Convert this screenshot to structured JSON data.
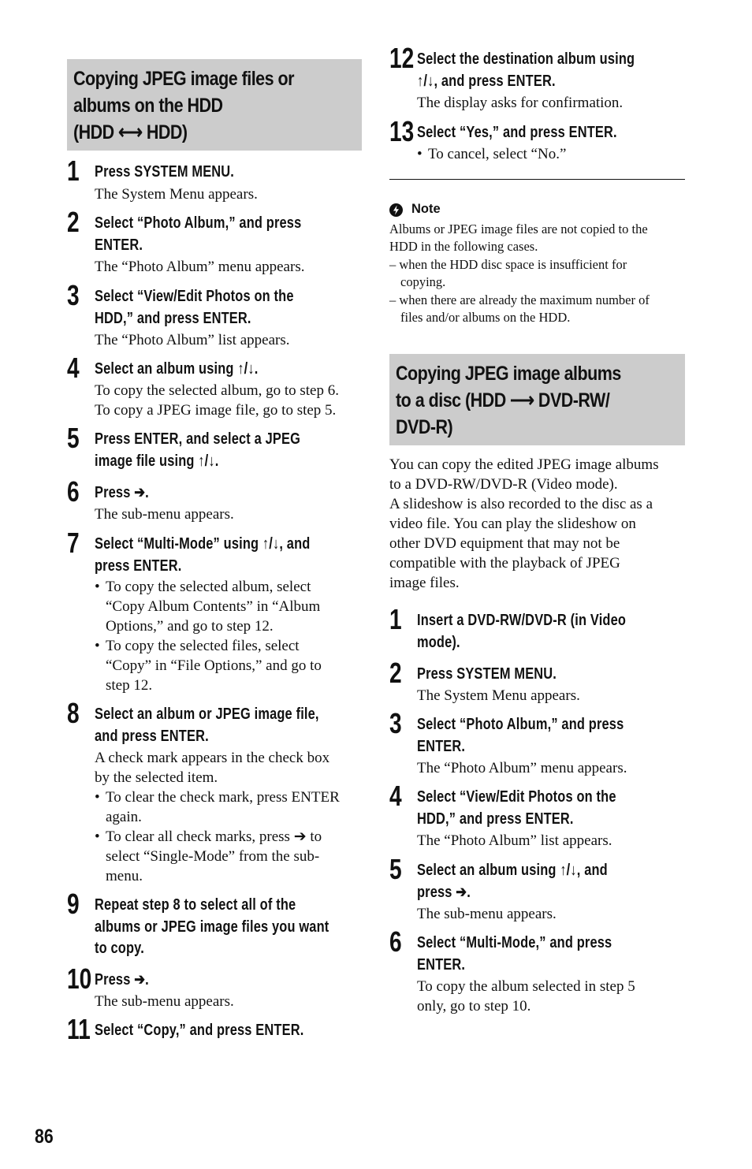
{
  "page_number": "86",
  "section1": {
    "heading_lines": [
      "Copying JPEG image files or",
      "albums on the HDD",
      "(HDD ⟷ HDD)"
    ],
    "steps": [
      {
        "num": "1",
        "title": [
          "Press SYSTEM MENU."
        ],
        "body": [
          "The System Menu appears."
        ]
      },
      {
        "num": "2",
        "title": [
          "Select “Photo Album,” and press",
          "ENTER."
        ],
        "body": [
          "The “Photo Album” menu appears."
        ]
      },
      {
        "num": "3",
        "title": [
          "Select “View/Edit Photos on the",
          "HDD,” and press ENTER."
        ],
        "body": [
          "The “Photo Album” list appears."
        ]
      },
      {
        "num": "4",
        "title": [
          "Select an album using ↑/↓."
        ],
        "body": [
          "To copy the selected album, go to step 6.",
          "To copy a JPEG image file, go to step 5."
        ]
      },
      {
        "num": "5",
        "title": [
          "Press ENTER, and select a JPEG",
          "image file using ↑/↓."
        ],
        "body": []
      },
      {
        "num": "6",
        "title": [
          "Press ➔."
        ],
        "body": [
          "The sub-menu appears."
        ]
      },
      {
        "num": "7",
        "title": [
          "Select “Multi-Mode” using ↑/↓, and",
          "press ENTER."
        ],
        "bullets": [
          [
            "To copy the selected album, select",
            "“Copy Album Contents” in “Album",
            "Options,” and go to step 12."
          ],
          [
            "To copy the selected files, select",
            "“Copy” in “File Options,” and go to",
            "step 12."
          ]
        ]
      },
      {
        "num": "8",
        "title": [
          "Select an album or JPEG image file,",
          "and press ENTER."
        ],
        "body": [
          "A check mark appears in the check box",
          "by the selected item."
        ],
        "bullets": [
          [
            "To clear the check mark, press ENTER",
            "again."
          ],
          [
            "To clear all check marks, press ➔ to",
            "select “Single-Mode” from the sub-",
            "menu."
          ]
        ]
      },
      {
        "num": "9",
        "title": [
          "Repeat step 8 to select all of the",
          "albums or JPEG image files you want",
          "to copy."
        ]
      },
      {
        "num": "10",
        "title": [
          "Press ➔."
        ],
        "body": [
          "The sub-menu appears."
        ]
      },
      {
        "num": "11",
        "title": [
          "Select “Copy,” and press ENTER."
        ]
      },
      {
        "num": "12",
        "title": [
          "Select the destination album using",
          "↑/↓, and press ENTER."
        ],
        "body": [
          "The display asks for confirmation."
        ]
      },
      {
        "num": "13",
        "title": [
          "Select “Yes,” and press ENTER."
        ],
        "bullets": [
          [
            "To cancel, select “No.”"
          ]
        ]
      }
    ]
  },
  "note": {
    "icon": "note-icon",
    "label": "Note",
    "lines": [
      "Albums or JPEG image files are not copied to the",
      "HDD in the following cases.",
      "– when the HDD disc space is insufficient for",
      "copying.",
      "– when there are already the maximum number of",
      "files and/or albums on the HDD."
    ]
  },
  "section2": {
    "heading_lines": [
      "Copying JPEG image albums",
      "to a disc (HDD ⟶ DVD-RW/",
      "DVD-R)"
    ],
    "intro": [
      "You can copy the edited JPEG image albums",
      "to a DVD-RW/DVD-R (Video mode).",
      "A slideshow is also recorded to the disc as a",
      "video file. You can play the slideshow on",
      "other DVD equipment that may not be",
      "compatible with the playback of JPEG",
      "image files."
    ],
    "steps": [
      {
        "num": "1",
        "title": [
          "Insert a DVD-RW/DVD-R (in Video",
          "mode)."
        ]
      },
      {
        "num": "2",
        "title": [
          "Press SYSTEM MENU."
        ],
        "body": [
          "The System Menu appears."
        ]
      },
      {
        "num": "3",
        "title": [
          "Select “Photo Album,” and press",
          "ENTER."
        ],
        "body": [
          "The “Photo Album” menu appears."
        ]
      },
      {
        "num": "4",
        "title": [
          "Select “View/Edit Photos on the",
          "HDD,” and press ENTER."
        ],
        "body": [
          "The “Photo Album” list appears."
        ]
      },
      {
        "num": "5",
        "title": [
          "Select an album using ↑/↓, and",
          "press ➔."
        ],
        "body": [
          "The sub-menu appears."
        ]
      },
      {
        "num": "6",
        "title": [
          "Select “Multi-Mode,” and press",
          "ENTER."
        ],
        "body": [
          "To copy the album selected in step 5",
          "only, go to step 10."
        ]
      }
    ]
  }
}
